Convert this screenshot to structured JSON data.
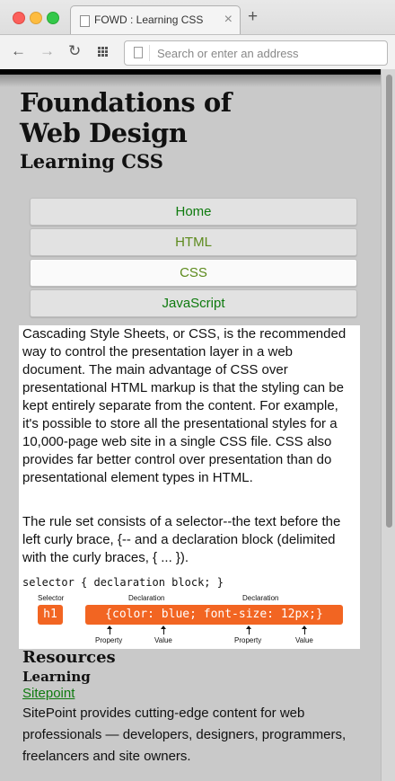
{
  "browser": {
    "tab_title": "FOWD : Learning CSS",
    "new_tab_symbol": "+",
    "address_placeholder": "Search or enter an address"
  },
  "site": {
    "title_line1": "Foundations of",
    "title_line2": "Web Design",
    "subtitle": "Learning CSS"
  },
  "nav": {
    "items": [
      {
        "label": "Home",
        "state": "link"
      },
      {
        "label": "HTML",
        "state": "visited"
      },
      {
        "label": "CSS",
        "state": "active"
      },
      {
        "label": "JavaScript",
        "state": "link"
      }
    ]
  },
  "content": {
    "paragraph1": "Cascading Style Sheets, or CSS, is the recommended way to control the presentation layer in a web document. The main advantage of CSS over presentational HTML markup is that the styling can be kept entirely separate from the content. For example, it's possible to store all the presentational styles for a 10,000-page web site in a single CSS file. CSS also provides far better control over presentation than do presentational element types in HTML.",
    "paragraph2": "The rule set consists of a selector--the text before the left curly brace, {-- and a declaration block (delimited with the curly braces, { ... }).",
    "code_line": "selector { declaration block; }",
    "diagram": {
      "selector_label": "Selector",
      "declaration_label_1": "Declaration",
      "declaration_label_2": "Declaration",
      "selector_code": "h1",
      "declaration_code": "{color: blue; font-size: 12px;}",
      "property_label_1": "Property",
      "value_label_1": "Value",
      "property_label_2": "Property",
      "value_label_2": "Value",
      "accent_color": "#f26522"
    }
  },
  "resources": {
    "title": "Resources",
    "subtitle": "Learning",
    "link_text": "Sitepoint",
    "description": "SitePoint provides cutting-edge content for web professionals — developers, designers, programmers, freelancers and site owners."
  },
  "colors": {
    "link_green": "#0e7a0e",
    "visited_green": "#5c8a1c",
    "page_background": "#c9c9c9"
  }
}
